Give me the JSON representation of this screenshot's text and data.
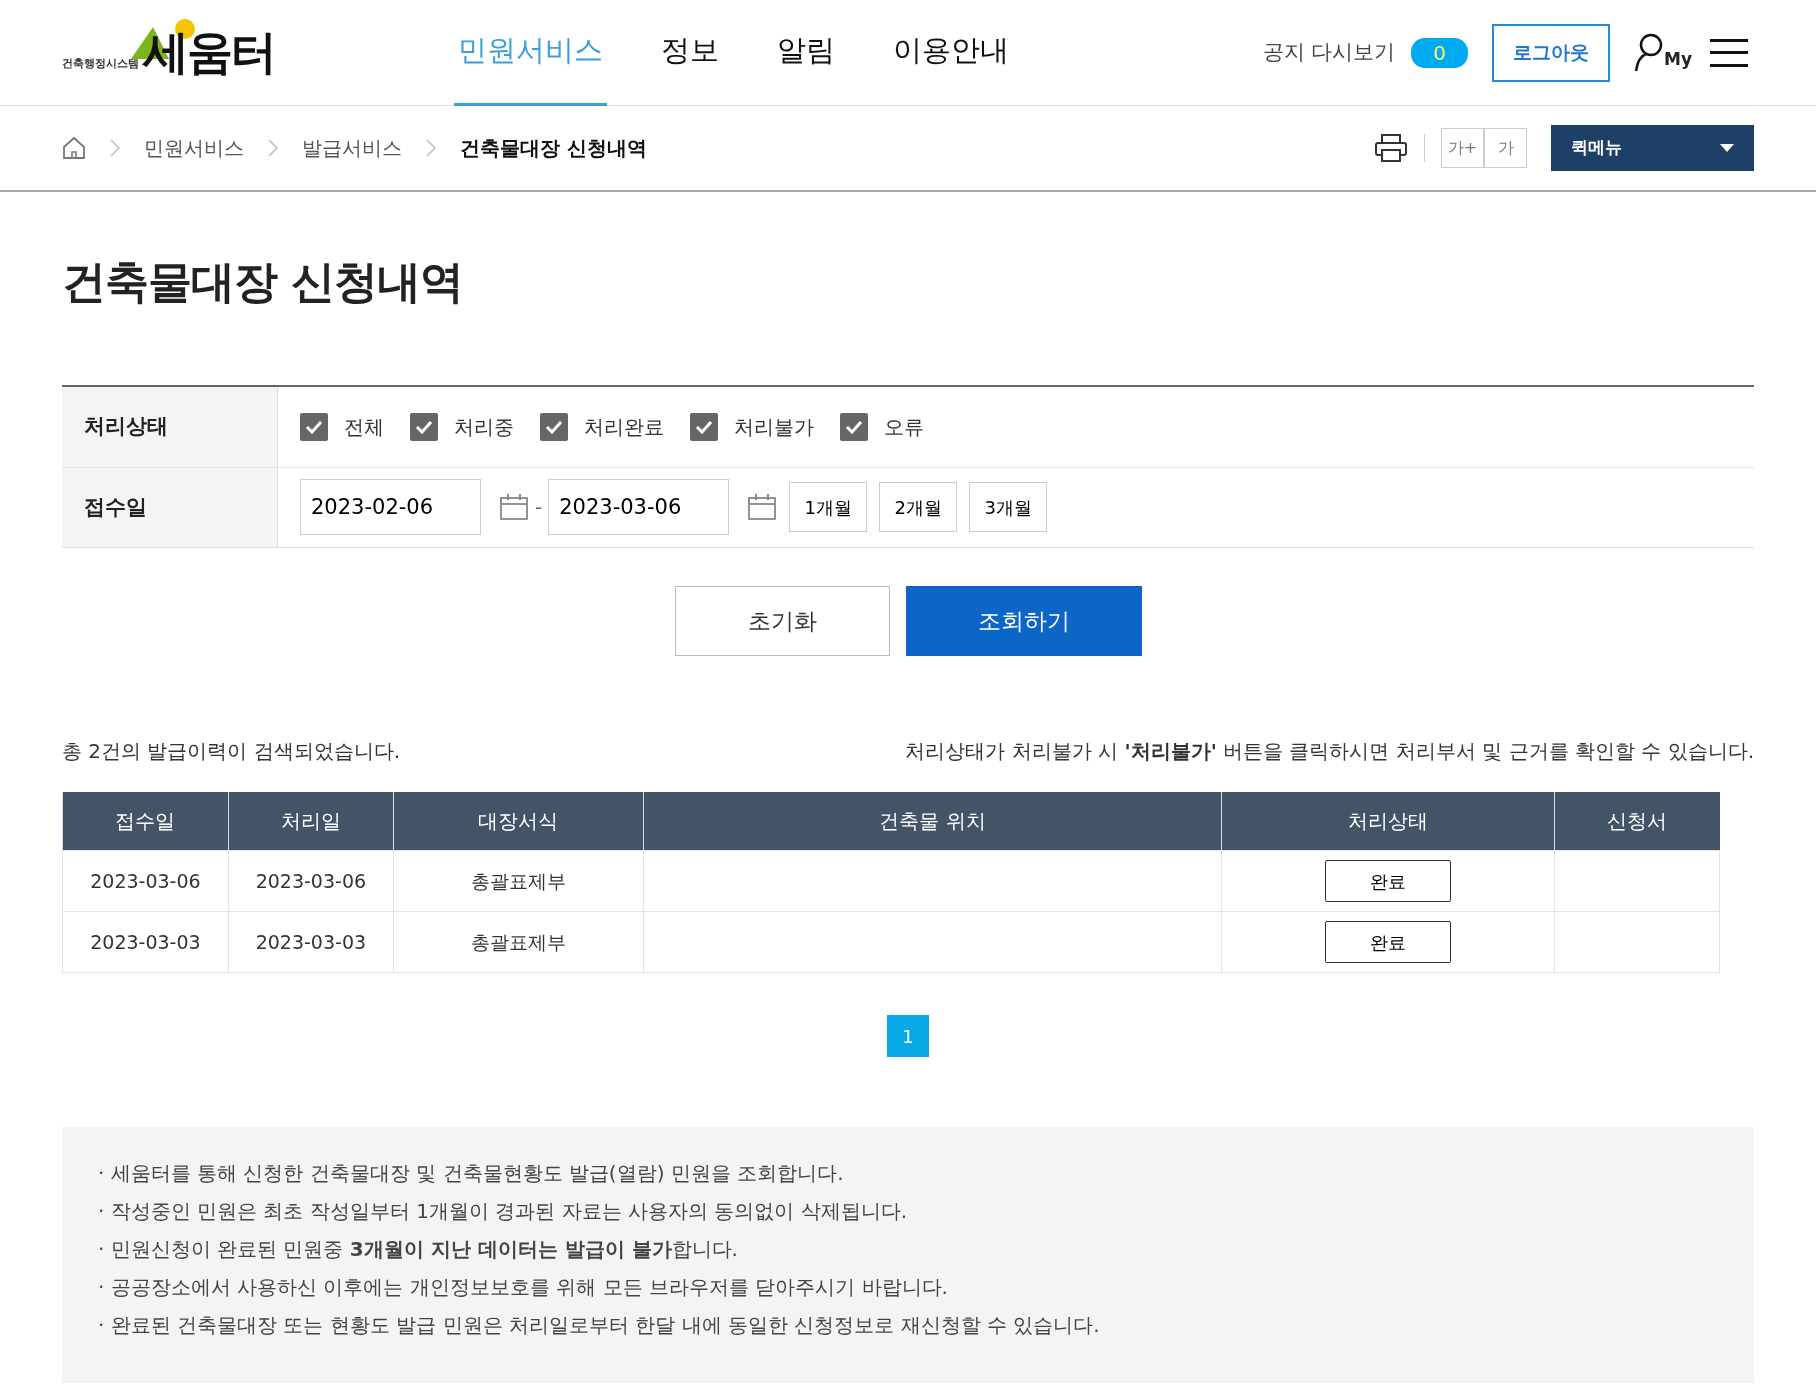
{
  "header": {
    "logo": {
      "name": "세움터",
      "subtitle": "건축행정시스템"
    },
    "nav": [
      {
        "label": "민원서비스",
        "selected": true
      },
      {
        "label": "정보",
        "selected": false
      },
      {
        "label": "알림",
        "selected": false
      },
      {
        "label": "이용안내",
        "selected": false
      }
    ],
    "notice_label": "공지 다시보기",
    "notice_count": "0",
    "logout": "로그아웃",
    "my_label": "My"
  },
  "breadcrumb": [
    "민원서비스",
    "발급서비스",
    "건축물대장 신청내역"
  ],
  "font_buttons": [
    "가+",
    "가"
  ],
  "quick_menu": "퀵메뉴",
  "page_title": "건축물대장 신청내역",
  "filter": {
    "status_label": "처리상태",
    "statuses": [
      {
        "label": "전체",
        "checked": true
      },
      {
        "label": "처리중",
        "checked": true
      },
      {
        "label": "처리완료",
        "checked": true
      },
      {
        "label": "처리불가",
        "checked": true
      },
      {
        "label": "오류",
        "checked": true
      }
    ],
    "date_label": "접수일",
    "date_from": "2023-02-06",
    "separator": "-",
    "date_to": "2023-03-06",
    "periods": [
      "1개월",
      "2개월",
      "3개월"
    ]
  },
  "actions": {
    "reset": "초기화",
    "search": "조회하기"
  },
  "summary": "총 2건의 발급이력이 검색되었습니다.",
  "hint": "처리상태가 처리불가 시 **'처리불가'** 버튼을 클릭하시면 처리부서 및 근거를 확인할 수 있습니다.",
  "table": {
    "columns": [
      "접수일",
      "처리일",
      "대장서식",
      "건축물 위치",
      "처리상태",
      "신청서"
    ],
    "rows": [
      {
        "received": "2023-03-06",
        "processed": "2023-03-06",
        "form": "총괄표제부",
        "status": "완료"
      },
      {
        "received": "2023-03-03",
        "processed": "2023-03-03",
        "form": "총괄표제부",
        "status": "완료"
      }
    ]
  },
  "pagination": [
    {
      "label": "1",
      "selected": true
    }
  ],
  "notes": [
    "· 세움터를 통해 신청한 건축물대장 및 건축물현황도 발급(열람) 민원을 조회합니다.",
    "· 작성중인 민원은 최초 작성일부터 1개월이 경과된 자료는 사용자의 동의없이 삭제됩니다.",
    "·  민원신청이 완료된 민원중 **3개월이 지난 데이터는 발급이 불가**합니다.",
    "· 공공장소에서 사용하신 이후에는 개인정보보호를 위해 모든 브라우저를 닫아주시기 바랍니다.",
    "· 완료된 건축물대장 또는 현황도 발급 민원은 처리일로부터 한달 내에 동일한 신청정보로 재신청할 수 있습니다."
  ]
}
